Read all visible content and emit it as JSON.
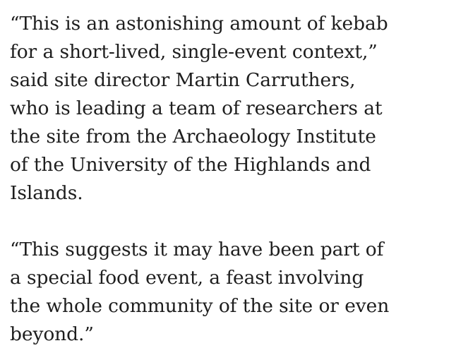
{
  "article": {
    "paragraphs": [
      {
        "lines": [
          "“This is an astonishing amount of kebab",
          "for a short-lived, single-event context,”",
          "said site director Martin Carruthers,",
          "who is leading a team of researchers at",
          "the site from the Archaeology Institute",
          "of the University of the Highlands and",
          "Islands."
        ]
      },
      {
        "lines": [
          "“This suggests it may have been part of",
          "a special food event, a feast involving",
          "the whole community of the site or even",
          "beyond.”"
        ]
      }
    ]
  }
}
